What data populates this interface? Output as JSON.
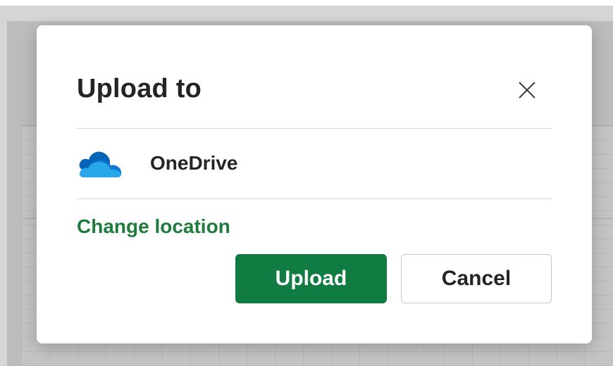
{
  "dialog": {
    "title": "Upload to",
    "location": {
      "name": "OneDrive",
      "icon": "onedrive-cloud-icon"
    },
    "change_location_label": "Change location",
    "upload_label": "Upload",
    "cancel_label": "Cancel",
    "close_icon": "close-icon"
  },
  "colors": {
    "accent": "#107c41",
    "link": "#1e7b3c",
    "onedrive_dark": "#0364b8",
    "onedrive_mid": "#0f78d4",
    "onedrive_light": "#28a8ea"
  }
}
